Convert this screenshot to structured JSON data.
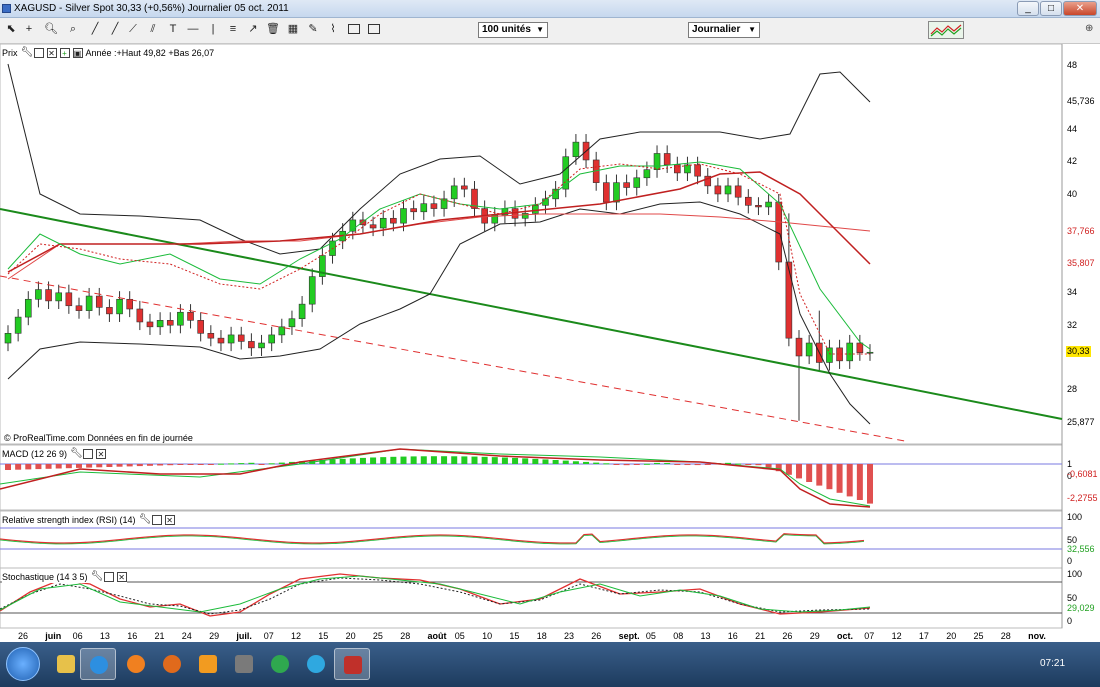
{
  "window": {
    "title": "XAGUSD - Silver Spot    30,33 (+0,56%)    Journalier  05 oct. 2011",
    "buttons": [
      "_",
      "□",
      "✕"
    ]
  },
  "toolbar": {
    "units_select": "100 unités",
    "period_select": "Journalier"
  },
  "price_panel": {
    "label": "Prix",
    "info": "Année :+Haut 49,82 +Bas 26,07",
    "footer": "© ProRealTime.com  Données en fin de journée",
    "axis_ticks": [
      "48",
      "44",
      "42",
      "40",
      "34",
      "32",
      "28"
    ],
    "tags": [
      {
        "text": "45,736",
        "color": "#000000",
        "bg": "#ffffff"
      },
      {
        "text": "37,766",
        "color": "#d02020",
        "bg": "#ffffff"
      },
      {
        "text": "35,807",
        "color": "#d02020",
        "bg": "#ffffff"
      },
      {
        "text": "30,33",
        "color": "#000000",
        "bg": "#ffe600"
      },
      {
        "text": "25,877",
        "color": "#000000",
        "bg": "#ffffff"
      }
    ]
  },
  "macd_panel": {
    "label": "MACD (12 26 9)",
    "axis_ticks": [
      "1",
      "0"
    ],
    "tags": [
      {
        "text": "-0,6081",
        "color": "#d02020"
      },
      {
        "text": "-2,2755",
        "color": "#d02020"
      }
    ]
  },
  "rsi_panel": {
    "label": "Relative strength index (RSI) (14)",
    "axis_ticks": [
      "100",
      "50",
      "0"
    ],
    "tags": [
      {
        "text": "32,556",
        "color": "#20a020"
      }
    ]
  },
  "stoch_panel": {
    "label": "Stochastique (14 3 5)",
    "axis_ticks": [
      "100",
      "50",
      "0"
    ],
    "tags": [
      {
        "text": "29,029",
        "color": "#20a020"
      }
    ]
  },
  "x_axis": {
    "labels": [
      "26",
      "juin",
      "06",
      "13",
      "16",
      "21",
      "24",
      "29",
      "juil.",
      "07",
      "12",
      "15",
      "20",
      "25",
      "28",
      "août",
      "05",
      "10",
      "15",
      "18",
      "23",
      "26",
      "sept.",
      "05",
      "08",
      "13",
      "16",
      "21",
      "26",
      "29",
      "oct.",
      "07",
      "12",
      "17",
      "20",
      "25",
      "28",
      "nov."
    ]
  },
  "taskbar": {
    "clock": "07:21"
  }
}
